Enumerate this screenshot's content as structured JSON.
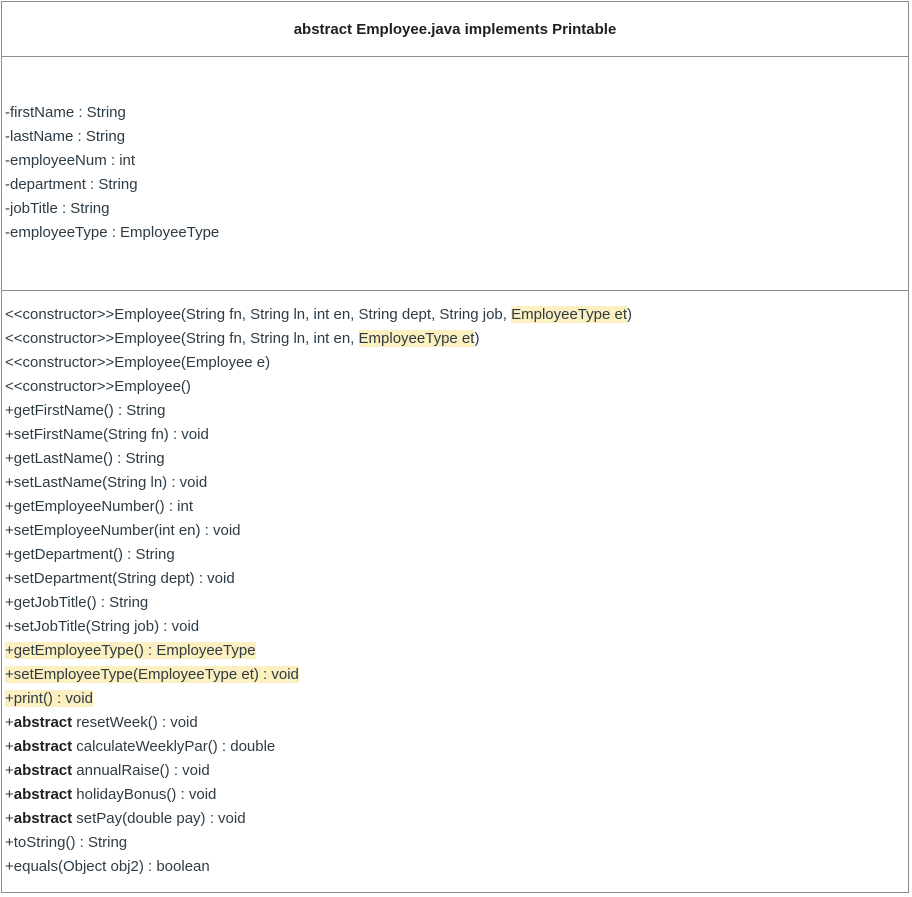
{
  "class_header": "abstract Employee.java implements Printable",
  "attributes": [
    "-firstName : String",
    "-lastName : String",
    "-employeeNum : int",
    "-department : String",
    "-jobTitle : String",
    "-employeeType : EmployeeType"
  ],
  "methods": [
    {
      "pre": "<<constructor>>Employee(String fn, String ln, int en, String dept, String job, ",
      "hl": "EmployeeType et",
      "post": ")"
    },
    {
      "pre": "<<constructor>>Employee(String fn, String ln, int en, ",
      "hl": "EmployeeType et",
      "post": ")"
    },
    {
      "text": "<<constructor>>Employee(Employee e)"
    },
    {
      "text": "<<constructor>>Employee()"
    },
    {
      "text": "+getFirstName() : String"
    },
    {
      "text": "+setFirstName(String fn) : void"
    },
    {
      "text": "+getLastName() : String"
    },
    {
      "text": "+setLastName(String ln) : void"
    },
    {
      "text": "+getEmployeeNumber() : int"
    },
    {
      "text": "+setEmployeeNumber(int en) : void"
    },
    {
      "text": "+getDepartment() : String"
    },
    {
      "text": "+setDepartment(String dept) : void"
    },
    {
      "text": "+getJobTitle() : String"
    },
    {
      "text": "+setJobTitle(String job) : void"
    },
    {
      "text": "+getEmployeeType() : EmployeeType",
      "highlight": true
    },
    {
      "text": "+setEmployeeType(EmployeeType et) : void",
      "highlight": true
    },
    {
      "text": "+print() : void",
      "highlight": true
    },
    {
      "pre": "+",
      "kw": "abstract",
      "post": " resetWeek() : void"
    },
    {
      "pre": "+",
      "kw": "abstract",
      "post": " calculateWeeklyPar() : double"
    },
    {
      "pre": "+",
      "kw": "abstract",
      "post": " annualRaise() : void"
    },
    {
      "pre": "+",
      "kw": "abstract",
      "post": " holidayBonus() : void"
    },
    {
      "pre": "+",
      "kw": "abstract",
      "post": " setPay(double pay) : void"
    },
    {
      "text": "+toString() : String"
    },
    {
      "text": "+equals(Object obj2) : boolean"
    }
  ],
  "colors": {
    "highlight": "#fcefc0",
    "border": "#8c8c8c",
    "text": "#2d3b45"
  }
}
